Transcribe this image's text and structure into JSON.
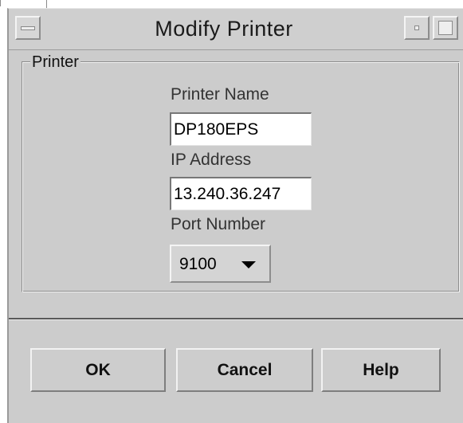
{
  "window": {
    "title": "Modify Printer",
    "controls": {
      "menu": "window-menu-icon",
      "minimize": "minimize-icon",
      "maximize": "maximize-icon"
    }
  },
  "group": {
    "label": "Printer"
  },
  "fields": {
    "printer_name": {
      "label": "Printer Name",
      "value": "DP180EPS"
    },
    "ip_address": {
      "label": "IP Address",
      "value": "13.240.36.247"
    },
    "port_number": {
      "label": "Port Number",
      "value": "9100",
      "icon": "dropdown-arrow-icon"
    }
  },
  "buttons": {
    "ok": "OK",
    "cancel": "Cancel",
    "help": "Help"
  },
  "colors": {
    "window_bg": "#cccccc",
    "field_bg": "#ffffff",
    "text": "#111111"
  }
}
